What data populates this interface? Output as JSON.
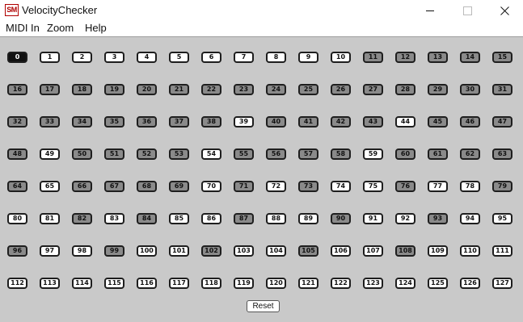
{
  "window": {
    "icon_text": "SM",
    "title": "VelocityChecker"
  },
  "menu": {
    "midi_in": "MIDI In",
    "zoom": "Zoom",
    "help": "Help"
  },
  "notes": [
    {
      "label": "0",
      "state": "active"
    },
    {
      "label": "1",
      "state": "off"
    },
    {
      "label": "2",
      "state": "off"
    },
    {
      "label": "3",
      "state": "off"
    },
    {
      "label": "4",
      "state": "off"
    },
    {
      "label": "5",
      "state": "off"
    },
    {
      "label": "6",
      "state": "off"
    },
    {
      "label": "7",
      "state": "off"
    },
    {
      "label": "8",
      "state": "off"
    },
    {
      "label": "9",
      "state": "off"
    },
    {
      "label": "10",
      "state": "off"
    },
    {
      "label": "11",
      "state": "on"
    },
    {
      "label": "12",
      "state": "on"
    },
    {
      "label": "13",
      "state": "on"
    },
    {
      "label": "14",
      "state": "on"
    },
    {
      "label": "15",
      "state": "on"
    },
    {
      "label": "16",
      "state": "on"
    },
    {
      "label": "17",
      "state": "on"
    },
    {
      "label": "18",
      "state": "on"
    },
    {
      "label": "19",
      "state": "on"
    },
    {
      "label": "20",
      "state": "on"
    },
    {
      "label": "21",
      "state": "on"
    },
    {
      "label": "22",
      "state": "on"
    },
    {
      "label": "23",
      "state": "on"
    },
    {
      "label": "24",
      "state": "on"
    },
    {
      "label": "25",
      "state": "on"
    },
    {
      "label": "26",
      "state": "on"
    },
    {
      "label": "27",
      "state": "on"
    },
    {
      "label": "28",
      "state": "on"
    },
    {
      "label": "29",
      "state": "on"
    },
    {
      "label": "30",
      "state": "on"
    },
    {
      "label": "31",
      "state": "on"
    },
    {
      "label": "32",
      "state": "on"
    },
    {
      "label": "33",
      "state": "on"
    },
    {
      "label": "34",
      "state": "on"
    },
    {
      "label": "35",
      "state": "on"
    },
    {
      "label": "36",
      "state": "on"
    },
    {
      "label": "37",
      "state": "on"
    },
    {
      "label": "38",
      "state": "on"
    },
    {
      "label": "39",
      "state": "off"
    },
    {
      "label": "40",
      "state": "on"
    },
    {
      "label": "41",
      "state": "on"
    },
    {
      "label": "42",
      "state": "on"
    },
    {
      "label": "43",
      "state": "on"
    },
    {
      "label": "44",
      "state": "off"
    },
    {
      "label": "45",
      "state": "on"
    },
    {
      "label": "46",
      "state": "on"
    },
    {
      "label": "47",
      "state": "on"
    },
    {
      "label": "48",
      "state": "on"
    },
    {
      "label": "49",
      "state": "off"
    },
    {
      "label": "50",
      "state": "on"
    },
    {
      "label": "51",
      "state": "on"
    },
    {
      "label": "52",
      "state": "on"
    },
    {
      "label": "53",
      "state": "on"
    },
    {
      "label": "54",
      "state": "off"
    },
    {
      "label": "55",
      "state": "on"
    },
    {
      "label": "56",
      "state": "on"
    },
    {
      "label": "57",
      "state": "on"
    },
    {
      "label": "58",
      "state": "on"
    },
    {
      "label": "59",
      "state": "off"
    },
    {
      "label": "60",
      "state": "on"
    },
    {
      "label": "61",
      "state": "on"
    },
    {
      "label": "62",
      "state": "on"
    },
    {
      "label": "63",
      "state": "on"
    },
    {
      "label": "64",
      "state": "on"
    },
    {
      "label": "65",
      "state": "off"
    },
    {
      "label": "66",
      "state": "on"
    },
    {
      "label": "67",
      "state": "on"
    },
    {
      "label": "68",
      "state": "on"
    },
    {
      "label": "69",
      "state": "on"
    },
    {
      "label": "70",
      "state": "off"
    },
    {
      "label": "71",
      "state": "on"
    },
    {
      "label": "72",
      "state": "off"
    },
    {
      "label": "73",
      "state": "on"
    },
    {
      "label": "74",
      "state": "off"
    },
    {
      "label": "75",
      "state": "off"
    },
    {
      "label": "76",
      "state": "on"
    },
    {
      "label": "77",
      "state": "off"
    },
    {
      "label": "78",
      "state": "off"
    },
    {
      "label": "79",
      "state": "on"
    },
    {
      "label": "80",
      "state": "off"
    },
    {
      "label": "81",
      "state": "off"
    },
    {
      "label": "82",
      "state": "on"
    },
    {
      "label": "83",
      "state": "off"
    },
    {
      "label": "84",
      "state": "on"
    },
    {
      "label": "85",
      "state": "off"
    },
    {
      "label": "86",
      "state": "off"
    },
    {
      "label": "87",
      "state": "on"
    },
    {
      "label": "88",
      "state": "off"
    },
    {
      "label": "89",
      "state": "off"
    },
    {
      "label": "90",
      "state": "on"
    },
    {
      "label": "91",
      "state": "off"
    },
    {
      "label": "92",
      "state": "off"
    },
    {
      "label": "93",
      "state": "on"
    },
    {
      "label": "94",
      "state": "off"
    },
    {
      "label": "95",
      "state": "off"
    },
    {
      "label": "96",
      "state": "on"
    },
    {
      "label": "97",
      "state": "off"
    },
    {
      "label": "98",
      "state": "off"
    },
    {
      "label": "99",
      "state": "on"
    },
    {
      "label": "100",
      "state": "off"
    },
    {
      "label": "101",
      "state": "off"
    },
    {
      "label": "102",
      "state": "on"
    },
    {
      "label": "103",
      "state": "off"
    },
    {
      "label": "104",
      "state": "off"
    },
    {
      "label": "105",
      "state": "on"
    },
    {
      "label": "106",
      "state": "off"
    },
    {
      "label": "107",
      "state": "off"
    },
    {
      "label": "108",
      "state": "on"
    },
    {
      "label": "109",
      "state": "off"
    },
    {
      "label": "110",
      "state": "off"
    },
    {
      "label": "111",
      "state": "off"
    },
    {
      "label": "112",
      "state": "off"
    },
    {
      "label": "113",
      "state": "off"
    },
    {
      "label": "114",
      "state": "off"
    },
    {
      "label": "115",
      "state": "off"
    },
    {
      "label": "116",
      "state": "off"
    },
    {
      "label": "117",
      "state": "off"
    },
    {
      "label": "118",
      "state": "off"
    },
    {
      "label": "119",
      "state": "off"
    },
    {
      "label": "120",
      "state": "off"
    },
    {
      "label": "121",
      "state": "off"
    },
    {
      "label": "122",
      "state": "off"
    },
    {
      "label": "123",
      "state": "off"
    },
    {
      "label": "124",
      "state": "off"
    },
    {
      "label": "125",
      "state": "off"
    },
    {
      "label": "126",
      "state": "off"
    },
    {
      "label": "127",
      "state": "off"
    }
  ],
  "reset_label": "Reset",
  "colors": {
    "active": "#111111",
    "on": "#8a8a8a",
    "off": "#ffffff",
    "panel_background": "#c9c9c9"
  }
}
